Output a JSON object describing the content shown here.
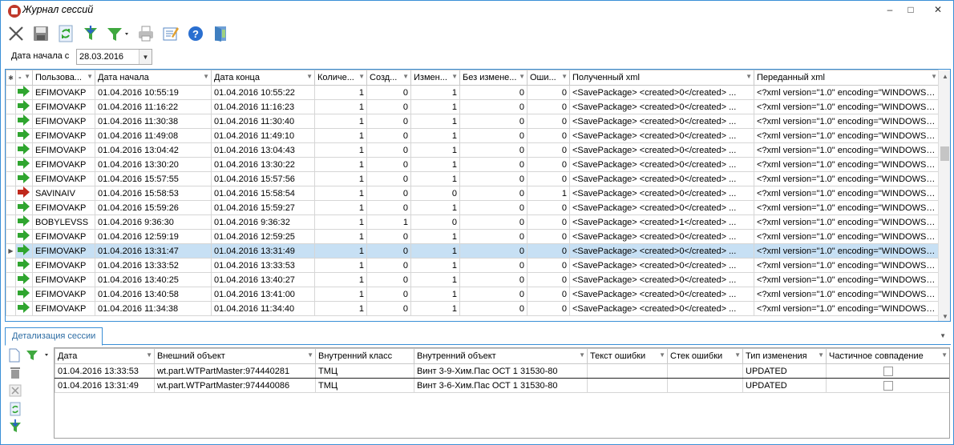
{
  "window": {
    "title": "Журнал сессий",
    "minimize": "–",
    "maximize": "□",
    "close": "✕"
  },
  "toolbar": {
    "icons": [
      "close-icon",
      "save-icon",
      "refresh-icon",
      "filter-apply-icon",
      "filter-icon",
      "print-icon",
      "edit-icon",
      "help-icon",
      "exit-icon"
    ]
  },
  "filter": {
    "label": "Дата начала с",
    "value": "28.03.2016",
    "dropdown": "▼"
  },
  "grid": {
    "columns": [
      "-",
      "Пользова...",
      "Дата начала",
      "Дата конца",
      "Количе...",
      "Созд...",
      "Измен...",
      "Без измене...",
      "Оши...",
      "Полученный xml",
      "Переданный xml"
    ],
    "selected_index": 11,
    "rows": [
      {
        "status": "ok",
        "user": "EFIMOVAKP",
        "start": "01.04.2016 10:55:19",
        "end": "01.04.2016 10:55:22",
        "count": "1",
        "created": "0",
        "changed": "1",
        "unchanged": "0",
        "errors": "0",
        "recv": "<SavePackage>   <created>0</created>  ...",
        "sent": "<?xml version=\"1.0\" encoding=\"WINDOWS-..."
      },
      {
        "status": "ok",
        "user": "EFIMOVAKP",
        "start": "01.04.2016 11:16:22",
        "end": "01.04.2016 11:16:23",
        "count": "1",
        "created": "0",
        "changed": "1",
        "unchanged": "0",
        "errors": "0",
        "recv": "<SavePackage>   <created>0</created>  ...",
        "sent": "<?xml version=\"1.0\" encoding=\"WINDOWS-..."
      },
      {
        "status": "ok",
        "user": "EFIMOVAKP",
        "start": "01.04.2016 11:30:38",
        "end": "01.04.2016 11:30:40",
        "count": "1",
        "created": "0",
        "changed": "1",
        "unchanged": "0",
        "errors": "0",
        "recv": "<SavePackage>   <created>0</created>  ...",
        "sent": "<?xml version=\"1.0\" encoding=\"WINDOWS-..."
      },
      {
        "status": "ok",
        "user": "EFIMOVAKP",
        "start": "01.04.2016 11:49:08",
        "end": "01.04.2016 11:49:10",
        "count": "1",
        "created": "0",
        "changed": "1",
        "unchanged": "0",
        "errors": "0",
        "recv": "<SavePackage>   <created>0</created>  ...",
        "sent": "<?xml version=\"1.0\" encoding=\"WINDOWS-..."
      },
      {
        "status": "ok",
        "user": "EFIMOVAKP",
        "start": "01.04.2016 13:04:42",
        "end": "01.04.2016 13:04:43",
        "count": "1",
        "created": "0",
        "changed": "1",
        "unchanged": "0",
        "errors": "0",
        "recv": "<SavePackage>   <created>0</created>  ...",
        "sent": "<?xml version=\"1.0\" encoding=\"WINDOWS-..."
      },
      {
        "status": "ok",
        "user": "EFIMOVAKP",
        "start": "01.04.2016 13:30:20",
        "end": "01.04.2016 13:30:22",
        "count": "1",
        "created": "0",
        "changed": "1",
        "unchanged": "0",
        "errors": "0",
        "recv": "<SavePackage>   <created>0</created>  ...",
        "sent": "<?xml version=\"1.0\" encoding=\"WINDOWS-..."
      },
      {
        "status": "ok",
        "user": "EFIMOVAKP",
        "start": "01.04.2016 15:57:55",
        "end": "01.04.2016 15:57:56",
        "count": "1",
        "created": "0",
        "changed": "1",
        "unchanged": "0",
        "errors": "0",
        "recv": "<SavePackage>   <created>0</created>  ...",
        "sent": "<?xml version=\"1.0\" encoding=\"WINDOWS-..."
      },
      {
        "status": "error",
        "user": "SAVINAIV",
        "start": "01.04.2016 15:58:53",
        "end": "01.04.2016 15:58:54",
        "count": "1",
        "created": "0",
        "changed": "0",
        "unchanged": "0",
        "errors": "1",
        "recv": "<SavePackage>   <created>0</created>  ...",
        "sent": "<?xml version=\"1.0\" encoding=\"WINDOWS-..."
      },
      {
        "status": "ok",
        "user": "EFIMOVAKP",
        "start": "01.04.2016 15:59:26",
        "end": "01.04.2016 15:59:27",
        "count": "1",
        "created": "0",
        "changed": "1",
        "unchanged": "0",
        "errors": "0",
        "recv": "<SavePackage>   <created>0</created>  ...",
        "sent": "<?xml version=\"1.0\" encoding=\"WINDOWS-..."
      },
      {
        "status": "ok",
        "user": "BOBYLEVSS",
        "start": "01.04.2016 9:36:30",
        "end": "01.04.2016 9:36:32",
        "count": "1",
        "created": "1",
        "changed": "0",
        "unchanged": "0",
        "errors": "0",
        "recv": "<SavePackage>   <created>1</created>  ...",
        "sent": "<?xml version=\"1.0\" encoding=\"WINDOWS-..."
      },
      {
        "status": "ok",
        "user": "EFIMOVAKP",
        "start": "01.04.2016 12:59:19",
        "end": "01.04.2016 12:59:25",
        "count": "1",
        "created": "0",
        "changed": "1",
        "unchanged": "0",
        "errors": "0",
        "recv": "<SavePackage>   <created>0</created>  ...",
        "sent": "<?xml version=\"1.0\" encoding=\"WINDOWS-..."
      },
      {
        "status": "ok",
        "user": "EFIMOVAKP",
        "start": "01.04.2016 13:31:47",
        "end": "01.04.2016 13:31:49",
        "count": "1",
        "created": "0",
        "changed": "1",
        "unchanged": "0",
        "errors": "0",
        "recv": "<SavePackage>   <created>0</created>  ...",
        "sent": "<?xml version=\"1.0\" encoding=\"WINDOWS-..."
      },
      {
        "status": "ok",
        "user": "EFIMOVAKP",
        "start": "01.04.2016 13:33:52",
        "end": "01.04.2016 13:33:53",
        "count": "1",
        "created": "0",
        "changed": "1",
        "unchanged": "0",
        "errors": "0",
        "recv": "<SavePackage>   <created>0</created>  ...",
        "sent": "<?xml version=\"1.0\" encoding=\"WINDOWS-..."
      },
      {
        "status": "ok",
        "user": "EFIMOVAKP",
        "start": "01.04.2016 13:40:25",
        "end": "01.04.2016 13:40:27",
        "count": "1",
        "created": "0",
        "changed": "1",
        "unchanged": "0",
        "errors": "0",
        "recv": "<SavePackage>   <created>0</created>  ...",
        "sent": "<?xml version=\"1.0\" encoding=\"WINDOWS-..."
      },
      {
        "status": "ok",
        "user": "EFIMOVAKP",
        "start": "01.04.2016 13:40:58",
        "end": "01.04.2016 13:41:00",
        "count": "1",
        "created": "0",
        "changed": "1",
        "unchanged": "0",
        "errors": "0",
        "recv": "<SavePackage>   <created>0</created>  ...",
        "sent": "<?xml version=\"1.0\" encoding=\"WINDOWS-..."
      },
      {
        "status": "ok",
        "user": "EFIMOVAKP",
        "start": "01.04.2016 11:34:38",
        "end": "01.04.2016 11:34:40",
        "count": "1",
        "created": "0",
        "changed": "1",
        "unchanged": "0",
        "errors": "0",
        "recv": "<SavePackage>   <created>0</created>  ...",
        "sent": "<?xml version=\"1.0\" encoding=\"WINDOWS-..."
      }
    ]
  },
  "detail_tab": {
    "label": "Детализация сессии"
  },
  "detail": {
    "columns": [
      "Дата",
      "Внешний объект",
      "Внутренний класс",
      "Внутренний объект",
      "Текст ошибки",
      "Стек ошибки",
      "Тип изменения",
      "Частичное совпадение"
    ],
    "rows": [
      {
        "date": "01.04.2016 13:33:53",
        "ext": "wt.part.WTPartMaster:974440281",
        "cls": "ТМЦ",
        "obj": "Винт 3-9-Хим.Пас ОСТ 1 31530-80",
        "err": "",
        "stack": "",
        "type": "UPDATED",
        "partial": false
      },
      {
        "date": "01.04.2016 13:31:49",
        "ext": "wt.part.WTPartMaster:974440086",
        "cls": "ТМЦ",
        "obj": "Винт 3-6-Хим.Пас ОСТ 1 31530-80",
        "err": "",
        "stack": "",
        "type": "UPDATED",
        "partial": false
      }
    ]
  },
  "colors": {
    "accent": "#3a8fd6",
    "selected": "#c7e0f4",
    "ok_arrow": "#2fa52f",
    "error_arrow": "#c0281c"
  }
}
